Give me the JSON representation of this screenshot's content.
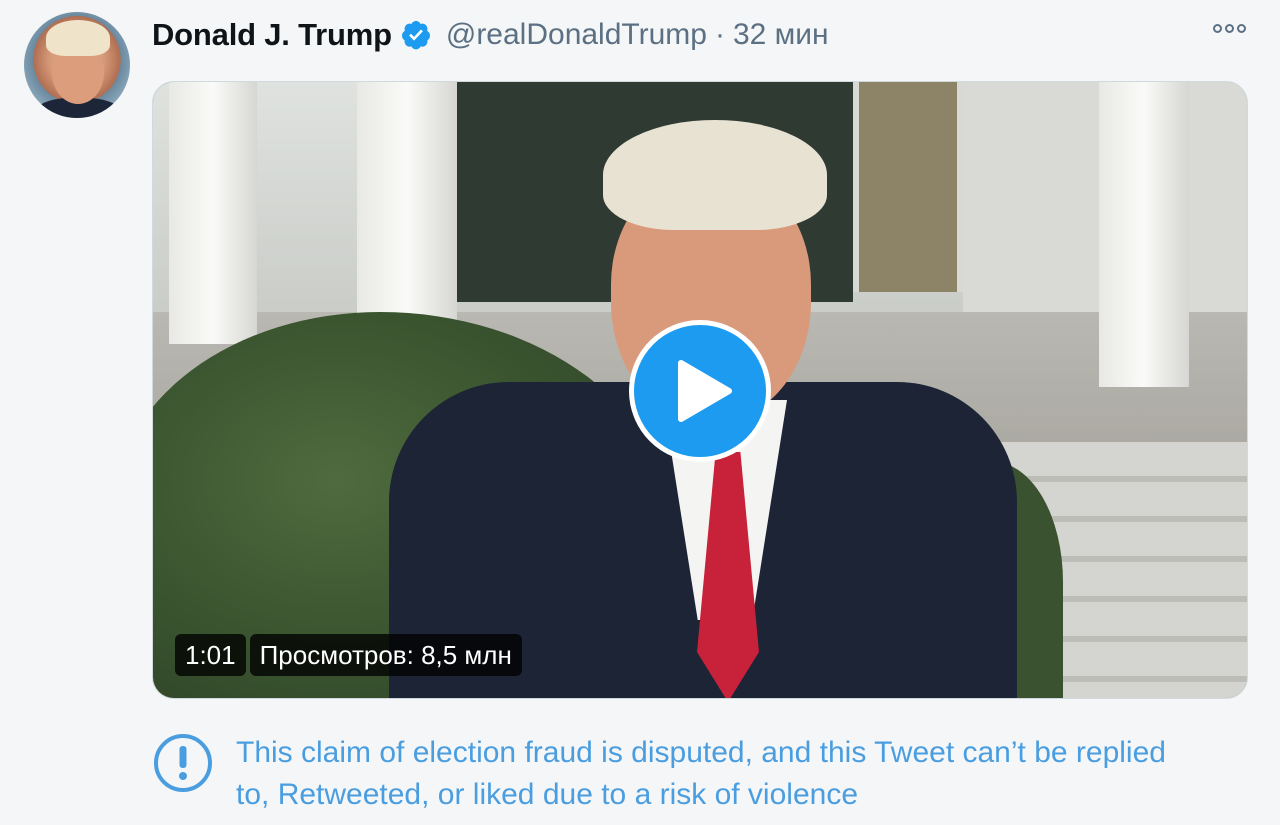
{
  "tweet": {
    "author_name": "Donald J. Trump",
    "handle": "@realDonaldTrump",
    "separator": "·",
    "time": "32 мин",
    "avatar_icon": "profile-photo",
    "verified_icon": "verified-badge-icon",
    "more_icon": "more-options-icon"
  },
  "media": {
    "type": "video",
    "duration": "1:01",
    "views": "Просмотров: 8,5 млн",
    "play_icon": "play-icon"
  },
  "notice": {
    "icon": "exclamation-circle-icon",
    "text": "This claim of election fraud is disputed, and this Tweet can’t be replied to, Retweeted, or liked due to a risk of violence"
  },
  "colors": {
    "accent": "#1d9bf0",
    "notice_text": "#4a9ee0",
    "secondary_text": "#5b7083",
    "primary_text": "#0f1419",
    "background": "#f5f6f7"
  }
}
